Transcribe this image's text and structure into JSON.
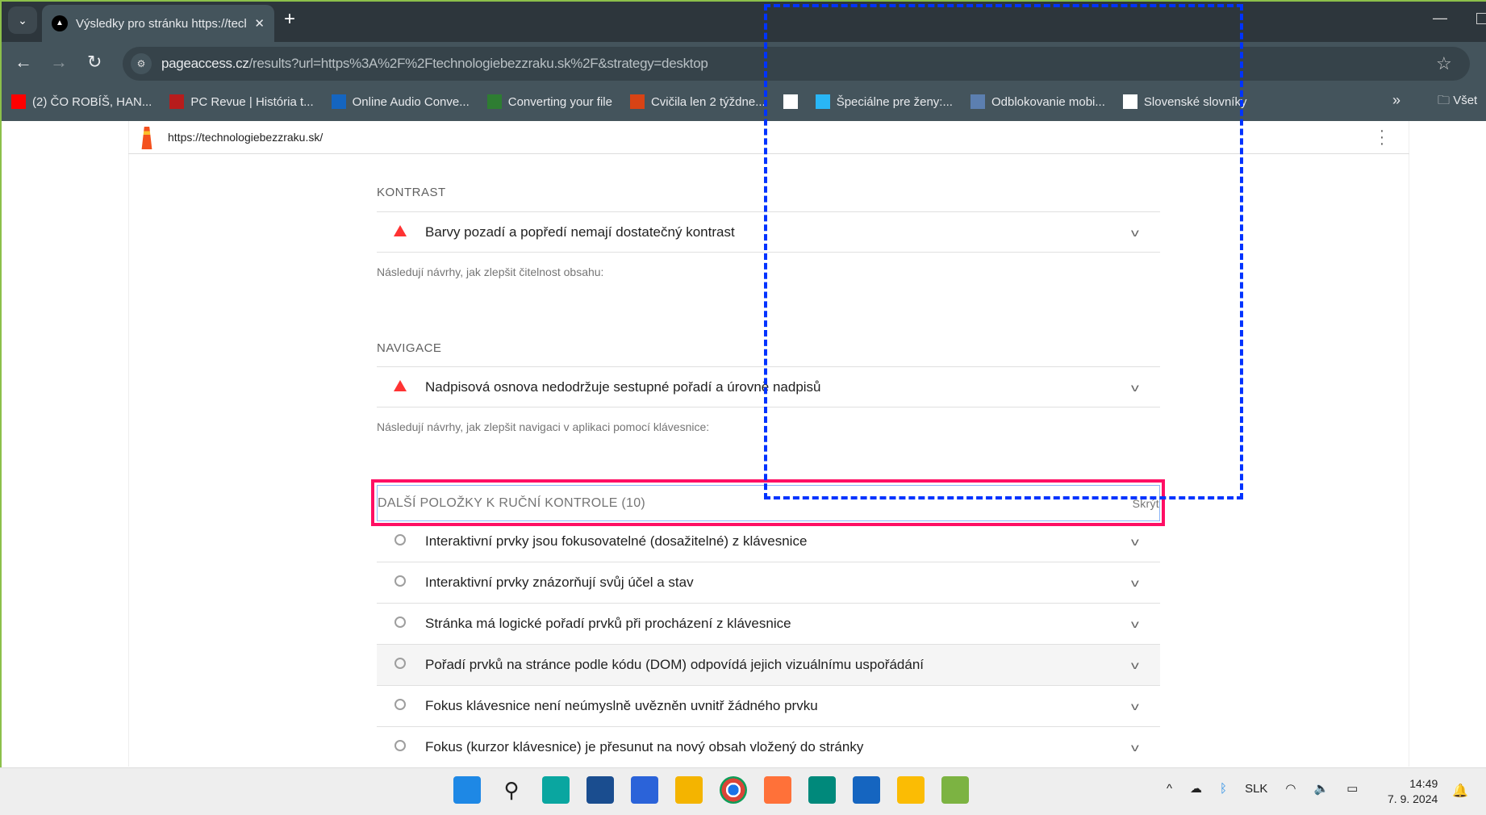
{
  "browser": {
    "tab_title": "Výsledky pro stránku https://technologiebezzraku.sk/",
    "url_domain": "pageaccess.cz",
    "url_rest": "/results?url=https%3A%2F%2Ftechnologiebezzraku.sk%2F&strategy=desktop",
    "bookmarks": [
      {
        "label": "(2) ČO ROBÍŠ, HAN...",
        "icon": "youtube-icon",
        "color": "#ff0000"
      },
      {
        "label": "PC Revue | História t...",
        "icon": "pc-revue-icon",
        "color": "#b71c1c"
      },
      {
        "label": "Online Audio Conve...",
        "icon": "play-icon",
        "color": "#1565c0"
      },
      {
        "label": "Converting your file",
        "icon": "figure-icon",
        "color": "#2e7d32"
      },
      {
        "label": "Cvičila len 2 týždne...",
        "icon": "bulb-icon",
        "color": "#d84315"
      },
      {
        "label": "",
        "icon": "app-icon",
        "color": "#ffffff"
      },
      {
        "label": "Špeciálne pre ženy:...",
        "icon": "heart-icon",
        "color": "#29b6f6"
      },
      {
        "label": "Odblokovanie mobi...",
        "icon": "pc-icon",
        "color": "#5c7fb0"
      },
      {
        "label": "Slovenské slovníky",
        "icon": "portrait-icon",
        "color": "#ffffff"
      }
    ],
    "all_bookmarks": "Všet"
  },
  "page": {
    "header_url": "https://technologiebezzraku.sk/",
    "sections": [
      {
        "title": "KONTRAST",
        "audit": "Barvy pozadí a popředí nemají dostatečný kontrast",
        "note": "Následují návrhy, jak zlepšit čitelnost obsahu:"
      },
      {
        "title": "NAVIGACE",
        "audit": "Nadpisová osnova nedodržuje sestupné pořadí a úrovně nadpisů",
        "note": "Následují návrhy, jak zlepšit navigaci v aplikaci pomocí klávesnice:"
      }
    ],
    "manual": {
      "title": "DALŠÍ POLOŽKY K RUČNÍ KONTROLE (10)",
      "hide": "Skrýt",
      "items": [
        "Interaktivní prvky jsou fokusovatelné (dosažitelné) z klávesnice",
        "Interaktivní prvky znázorňují svůj účel a stav",
        "Stránka má logické pořadí prvků při procházení z klávesnice",
        "Pořadí prvků na stránce podle kódu (DOM) odpovídá jejich vizuálnímu uspořádání",
        "Fokus klávesnice není neúmyslně uvězněn uvnitř žádného prvku",
        "Fokus (kurzor klávesnice) je přesunut na nový obsah vložený do stránky"
      ]
    },
    "fail_color": "#ff3333"
  },
  "taskbar": {
    "apps": [
      "start-icon",
      "search-icon",
      "edge-icon",
      "store-icon",
      "editor-icon",
      "explorer-icon",
      "chrome-icon",
      "firefox-icon",
      "meet-icon",
      "todo-icon",
      "drive-icon",
      "notepad-icon"
    ],
    "language": "SLK",
    "time": "14:49",
    "date": "7. 9. 2024"
  }
}
